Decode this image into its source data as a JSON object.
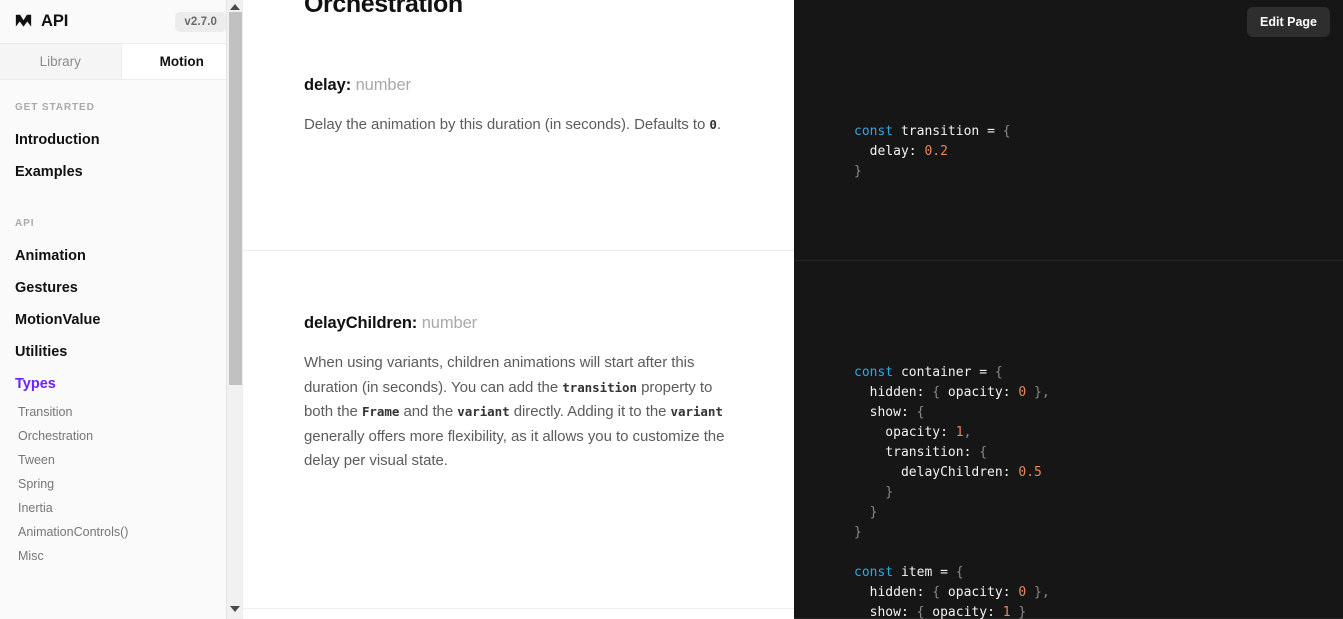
{
  "sidebar": {
    "brand_title": "API",
    "logo_icon": "framer-motion-logo-icon",
    "version": "v2.7.0",
    "tabs": [
      {
        "label": "Library",
        "active": false
      },
      {
        "label": "Motion",
        "active": true
      }
    ],
    "groups": [
      {
        "heading": "GET STARTED",
        "items": [
          {
            "label": "Introduction",
            "active": false
          },
          {
            "label": "Examples",
            "active": false
          }
        ]
      },
      {
        "heading": "API",
        "items": [
          {
            "label": "Animation",
            "active": false
          },
          {
            "label": "Gestures",
            "active": false
          },
          {
            "label": "MotionValue",
            "active": false
          },
          {
            "label": "Utilities",
            "active": false
          },
          {
            "label": "Types",
            "active": true
          }
        ],
        "subitems": [
          {
            "label": "Transition"
          },
          {
            "label": "Orchestration"
          },
          {
            "label": "Tween"
          },
          {
            "label": "Spring"
          },
          {
            "label": "Inertia"
          },
          {
            "label": "AnimationControls()"
          },
          {
            "label": "Misc"
          }
        ]
      }
    ],
    "accent_color": "#6b21ff"
  },
  "toolbar": {
    "edit_page_label": "Edit Page"
  },
  "main": {
    "page_title": "Orchestration",
    "sections": [
      {
        "prop_name": "delay:",
        "prop_type": "number",
        "desc_html": "Delay the animation by this duration (in seconds). Defaults to <code>0</code>.",
        "code_lines": [
          [
            {
              "t": "const ",
              "c": "k"
            },
            {
              "t": "transition",
              "c": "i"
            },
            {
              "t": " = ",
              "c": "i"
            },
            {
              "t": "{",
              "c": "p"
            }
          ],
          [
            {
              "t": "  delay: ",
              "c": "i"
            },
            {
              "t": "0.2",
              "c": "n"
            }
          ],
          [
            {
              "t": "}",
              "c": "p"
            }
          ]
        ]
      },
      {
        "prop_name": "delayChildren:",
        "prop_type": "number",
        "desc_html": "When using variants, children animations will start after this duration (in seconds). You can add the <code>transition</code> property to both the <code>Frame</code> and the <code>variant</code> directly. Adding it to the <code>variant</code> generally offers more flexibility, as it allows you to customize the delay per visual state.",
        "code_lines": [
          [
            {
              "t": "const ",
              "c": "k"
            },
            {
              "t": "container",
              "c": "i"
            },
            {
              "t": " = ",
              "c": "i"
            },
            {
              "t": "{",
              "c": "p"
            }
          ],
          [
            {
              "t": "  hidden: ",
              "c": "i"
            },
            {
              "t": "{",
              "c": "p"
            },
            {
              "t": " opacity: ",
              "c": "i"
            },
            {
              "t": "0",
              "c": "n"
            },
            {
              "t": " },",
              "c": "p"
            }
          ],
          [
            {
              "t": "  show: ",
              "c": "i"
            },
            {
              "t": "{",
              "c": "p"
            }
          ],
          [
            {
              "t": "    opacity: ",
              "c": "i"
            },
            {
              "t": "1",
              "c": "n"
            },
            {
              "t": ",",
              "c": "p"
            }
          ],
          [
            {
              "t": "    transition: ",
              "c": "i"
            },
            {
              "t": "{",
              "c": "p"
            }
          ],
          [
            {
              "t": "      delayChildren: ",
              "c": "i"
            },
            {
              "t": "0.5",
              "c": "n"
            }
          ],
          [
            {
              "t": "    }",
              "c": "p"
            }
          ],
          [
            {
              "t": "  }",
              "c": "p"
            }
          ],
          [
            {
              "t": "}",
              "c": "p"
            }
          ],
          [
            {
              "t": "",
              "c": "p"
            }
          ],
          [
            {
              "t": "const ",
              "c": "k"
            },
            {
              "t": "item",
              "c": "i"
            },
            {
              "t": " = ",
              "c": "i"
            },
            {
              "t": "{",
              "c": "p"
            }
          ],
          [
            {
              "t": "  hidden: ",
              "c": "i"
            },
            {
              "t": "{",
              "c": "p"
            },
            {
              "t": " opacity: ",
              "c": "i"
            },
            {
              "t": "0",
              "c": "n"
            },
            {
              "t": " },",
              "c": "p"
            }
          ],
          [
            {
              "t": "  show: ",
              "c": "i"
            },
            {
              "t": "{",
              "c": "p"
            },
            {
              "t": " opacity: ",
              "c": "i"
            },
            {
              "t": "1",
              "c": "n"
            },
            {
              "t": " }",
              "c": "p"
            }
          ]
        ]
      }
    ]
  },
  "colors": {
    "code_bg": "#161616",
    "keyword": "#2fa8e0",
    "number": "#e8865a",
    "punctuation": "#8a8a8a"
  }
}
